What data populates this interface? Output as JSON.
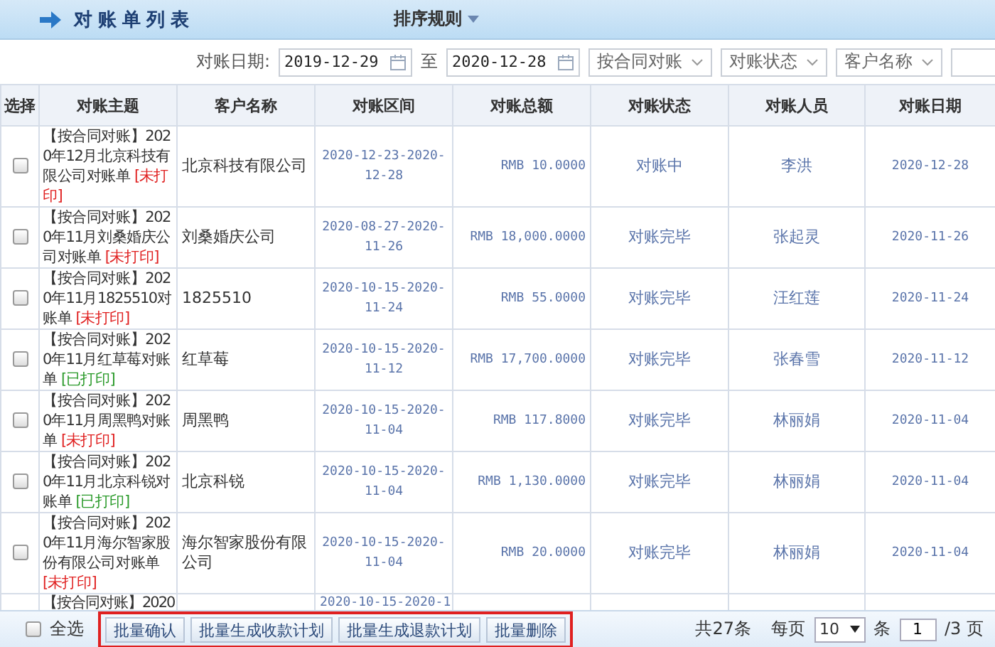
{
  "header": {
    "title": "对账单列表",
    "sort_menu": "排序规则"
  },
  "filters": {
    "date_label": "对账日期:",
    "date_from": "2019-12-29",
    "separator": "至",
    "date_to": "2020-12-28",
    "selects": [
      "按合同对账",
      "对账状态",
      "客户名称"
    ]
  },
  "table": {
    "columns": [
      "选择",
      "对账主题",
      "客户名称",
      "对账区间",
      "对账总额",
      "对账状态",
      "对账人员",
      "对账日期"
    ],
    "rows": [
      {
        "checked": false,
        "topic": "【按合同对账】2020年12月北京科技有限公司对账单",
        "print_tag": "[未打印]",
        "printed": false,
        "customer": "北京科技有限公司",
        "interval": "2020-12-23-2020-12-28",
        "total": "RMB 10.0000",
        "status": "对账中",
        "person": "李洪",
        "date": "2020-12-28"
      },
      {
        "checked": false,
        "topic": "【按合同对账】2020年11月刘桑婚庆公司对账单",
        "print_tag": "[未打印]",
        "printed": false,
        "customer": "刘桑婚庆公司",
        "interval": "2020-08-27-2020-11-26",
        "total": "RMB 18,000.0000",
        "status": "对账完毕",
        "person": "张起灵",
        "date": "2020-11-26"
      },
      {
        "checked": false,
        "topic": "【按合同对账】2020年11月1825510对账单",
        "print_tag": "[未打印]",
        "printed": false,
        "customer": "1825510",
        "interval": "2020-10-15-2020-11-24",
        "total": "RMB 55.0000",
        "status": "对账完毕",
        "person": "汪红莲",
        "date": "2020-11-24"
      },
      {
        "checked": false,
        "topic": "【按合同对账】2020年11月红草莓对账单",
        "print_tag": "[已打印]",
        "printed": true,
        "customer": "红草莓",
        "interval": "2020-10-15-2020-11-12",
        "total": "RMB 17,700.0000",
        "status": "对账完毕",
        "person": "张春雪",
        "date": "2020-11-12"
      },
      {
        "checked": false,
        "topic": "【按合同对账】2020年11月周黑鸭对账单",
        "print_tag": "[未打印]",
        "printed": false,
        "customer": "周黑鸭",
        "interval": "2020-10-15-2020-11-04",
        "total": "RMB 117.8000",
        "status": "对账完毕",
        "person": "林丽娟",
        "date": "2020-11-04"
      },
      {
        "checked": false,
        "topic": "【按合同对账】2020年11月北京科锐对账单",
        "print_tag": "[已打印]",
        "printed": true,
        "customer": "北京科锐",
        "interval": "2020-10-15-2020-11-04",
        "total": "RMB 1,130.0000",
        "status": "对账完毕",
        "person": "林丽娟",
        "date": "2020-11-04"
      },
      {
        "checked": false,
        "topic": "【按合同对账】2020年11月海尔智家股份有限公司对账单",
        "print_tag": "[未打印]",
        "printed": false,
        "customer": "海尔智家股份有限公司",
        "interval": "2020-10-15-2020-11-04",
        "total": "RMB 20.0000",
        "status": "对账完毕",
        "person": "林丽娟",
        "date": "2020-11-04"
      }
    ],
    "partial_row": {
      "topic": "【按合同对账】2020",
      "interval": "2020-10-15-2020-1"
    }
  },
  "footer": {
    "select_all": {
      "label": "全选",
      "checked": false
    },
    "buttons": [
      "批量确认",
      "批量生成收款计划",
      "批量生成退款计划",
      "批量删除"
    ],
    "total": "共27条",
    "per_page_label": "每页",
    "per_page": "10",
    "per_page_unit": "条",
    "page": "1",
    "pages": "/3 页"
  }
}
